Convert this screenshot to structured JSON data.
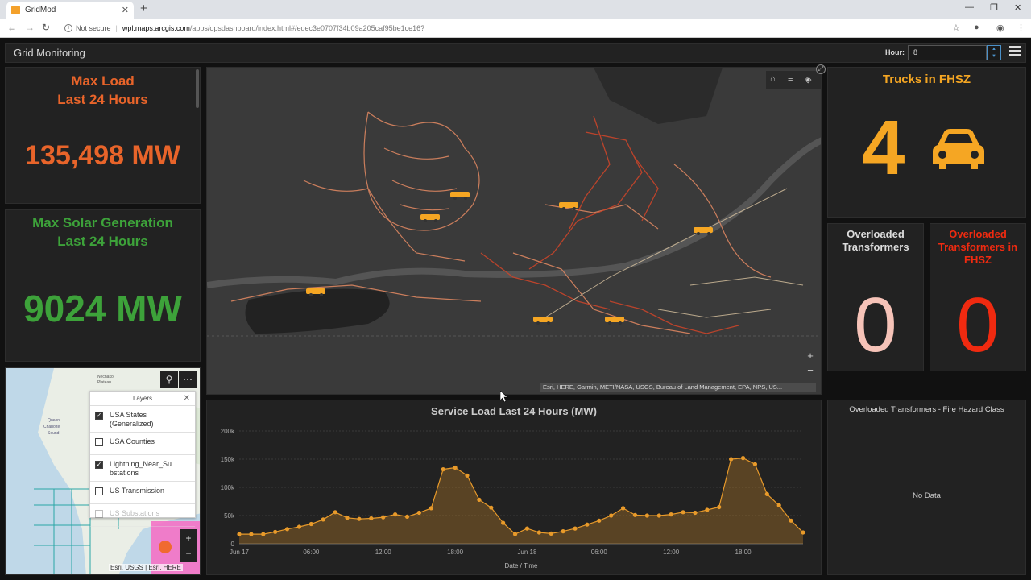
{
  "browser": {
    "tab_title": "GridMod",
    "new_tab": "+",
    "tab_close": "✕",
    "url_not_secure": "Not secure",
    "url_host": "wpl.maps.arcgis.com",
    "url_path": "/apps/opsdashboard/index.html#/edec3e0707f34b09a205caf95be1ce16?"
  },
  "header": {
    "title": "Grid Monitoring",
    "hour_label": "Hour:",
    "hour_value": "8"
  },
  "indicators": {
    "max_load_title_1": "Max Load",
    "max_load_title_2": "Last 24 Hours",
    "max_load_value": "135,498 MW",
    "solar_title_1": "Max Solar Generation",
    "solar_title_2": "Last 24 Hours",
    "solar_value": "9024 MW",
    "trucks_title": "Trucks in FHSZ",
    "trucks_value": "4",
    "overloaded_title_1": "Overloaded",
    "overloaded_title_2": "Transformers",
    "overloaded_value": "0",
    "overloaded_fhsz_title_1": "Overloaded",
    "overloaded_fhsz_title_2": "Transformers in",
    "overloaded_fhsz_title_3": "FHSZ",
    "overloaded_fhsz_value": "0"
  },
  "colors": {
    "load": "#e8642a",
    "solar": "#3da23a",
    "trucks": "#f5a623",
    "overloaded": "#f6c3b8",
    "overloaded_fhsz": "#f02a10",
    "chart_line": "#e89a2a"
  },
  "map": {
    "attribution": "Esri, HERE, Garmin, METI/NASA, USGS, Bureau of Land Management, EPA, NPS, US...",
    "zoom_in": "+",
    "zoom_out": "−",
    "truck_icon": "truck-icon"
  },
  "small_map": {
    "label_1": "Nechako",
    "label_2": "Plateau",
    "label_3": "Queen",
    "label_4": "Charlotte",
    "label_5": "Sound",
    "attribution": "Esri, USGS | Esri, HERE",
    "zoom_in": "+",
    "zoom_out": "−"
  },
  "layers_panel": {
    "title": "Layers",
    "close": "✕",
    "items": [
      {
        "label": "USA States (Generalized)",
        "checked": true
      },
      {
        "label": "USA Counties",
        "checked": false
      },
      {
        "label": "Lightning_Near_Substations",
        "checked": true
      },
      {
        "label": "US Transmission",
        "checked": false
      },
      {
        "label": "US Substations",
        "checked": false
      }
    ]
  },
  "fire_panel": {
    "title": "Overloaded Transformers - Fire Hazard Class",
    "empty": "No Data"
  },
  "chart_data": {
    "type": "area",
    "title": "Service Load Last 24 Hours (MW)",
    "xlabel": "Date / Time",
    "ylabel": "",
    "ylim": [
      0,
      200000
    ],
    "y_ticks": [
      "0",
      "50k",
      "100k",
      "150k",
      "200k"
    ],
    "x_ticks": [
      "Jun 17",
      "06:00",
      "12:00",
      "18:00",
      "Jun 18",
      "06:00",
      "12:00",
      "18:00"
    ],
    "x_tick_hours": [
      0,
      6,
      12,
      18,
      24,
      30,
      36,
      42
    ],
    "series": [
      {
        "x_hours": [
          0,
          1,
          2,
          3,
          4,
          5,
          6,
          7,
          8,
          9,
          10,
          11,
          12,
          13,
          14,
          15,
          16,
          17,
          18,
          19,
          20,
          21,
          22,
          23,
          24,
          25,
          26,
          27,
          28,
          29,
          30,
          31,
          32,
          33,
          34,
          35,
          36,
          37,
          38,
          39,
          40,
          41,
          42,
          43,
          44,
          45,
          46,
          47
        ],
        "values": [
          17000,
          17000,
          17000,
          21000,
          26000,
          30000,
          35000,
          43000,
          56000,
          46000,
          44000,
          45000,
          47000,
          52000,
          48000,
          55000,
          63000,
          132000,
          135000,
          121000,
          78000,
          64000,
          37000,
          17000,
          27000,
          20000,
          18000,
          22000,
          27000,
          34000,
          41000,
          50000,
          63000,
          51000,
          50000,
          50000,
          52000,
          56000,
          55000,
          60000,
          65000,
          150000,
          152000,
          141000,
          88000,
          68000,
          41000,
          20000
        ]
      }
    ]
  }
}
